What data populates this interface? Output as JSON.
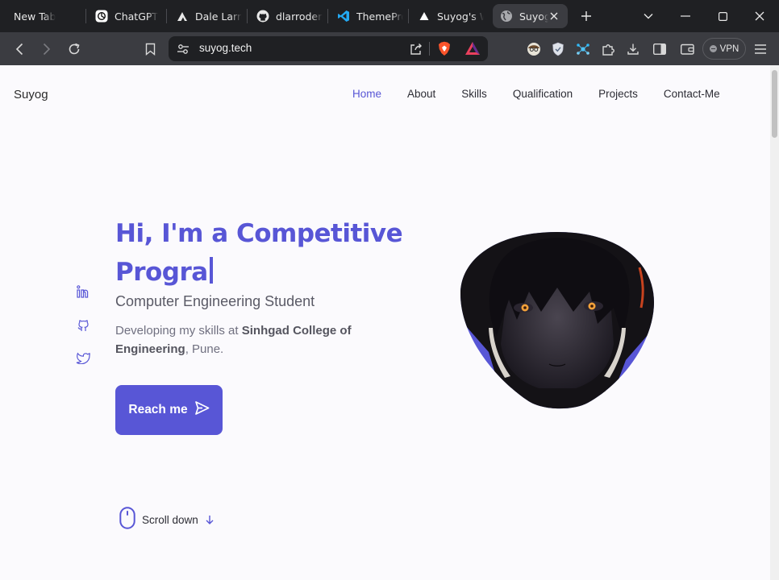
{
  "browser": {
    "tabs": [
      {
        "label": "New Tab",
        "icon": "none"
      },
      {
        "label": "ChatGPT",
        "icon": "chatgpt-icon"
      },
      {
        "label": "Dale Larroder",
        "icon": "dale-logo-icon"
      },
      {
        "label": "dlarroder/",
        "icon": "github-icon"
      },
      {
        "label": "ThemePro",
        "icon": "vscode-icon"
      },
      {
        "label": "Suyog's W",
        "icon": "vercel-icon"
      },
      {
        "label": "Suyog",
        "icon": "globe-icon",
        "active": true
      }
    ],
    "url": "suyog.tech",
    "vpn_label": "VPN"
  },
  "site": {
    "brand": "Suyog",
    "nav": [
      "Home",
      "About",
      "Skills",
      "Qualification",
      "Projects",
      "Contact-Me"
    ],
    "active_nav": "Home",
    "hero": {
      "title": "Hi, I'm a Competitive Progra",
      "subtitle": "Computer Engineering Student",
      "desc_prefix": "Developing my skills at ",
      "desc_bold": "Sinhgad College of Engineering",
      "desc_suffix": ", Pune.",
      "button_label": "Reach me"
    },
    "social_icons": [
      "linkedin-icon",
      "github-icon",
      "twitter-icon"
    ],
    "scroll_label": "Scroll down"
  },
  "colors": {
    "accent": "#5856d6",
    "page_bg": "#fbfafd",
    "browser_bg": "#1f2023",
    "toolbar_bg": "#3b3c41"
  }
}
